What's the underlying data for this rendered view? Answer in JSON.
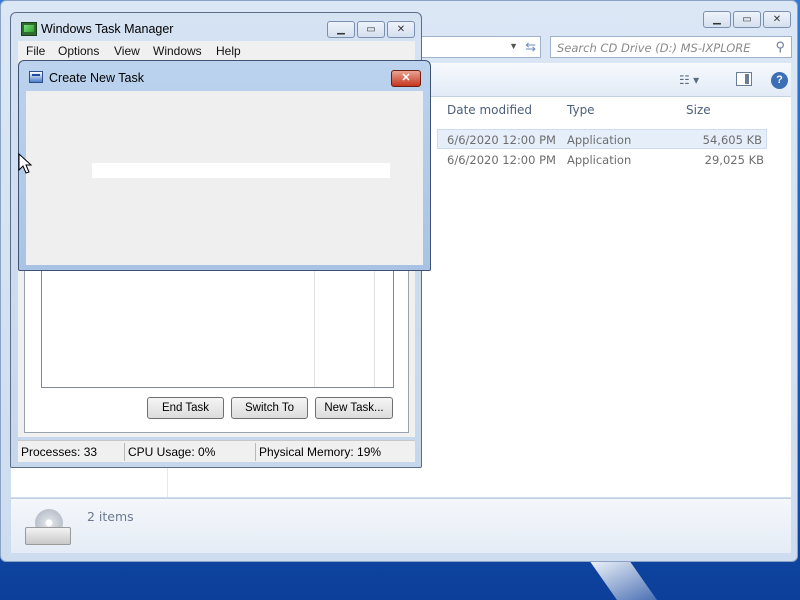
{
  "explorer": {
    "search_placeholder": "Search CD Drive (D:) MS-IXPLORE",
    "columns": {
      "date_modified": "Date modified",
      "type": "Type",
      "size": "Size"
    },
    "files": [
      {
        "date": "6/6/2020 12:00 PM",
        "type": "Application",
        "size": "54,605 KB",
        "selected": true
      },
      {
        "date": "6/6/2020 12:00 PM",
        "type": "Application",
        "size": "29,025 KB",
        "selected": false
      }
    ],
    "item_count": "2 items"
  },
  "task_manager": {
    "title": "Windows Task Manager",
    "menu": [
      "File",
      "Options",
      "View",
      "Windows",
      "Help"
    ],
    "buttons": {
      "end_task": "End Task",
      "switch_to": "Switch To",
      "new_task": "New Task..."
    },
    "status": {
      "processes": "Processes: 33",
      "cpu": "CPU Usage: 0%",
      "memory": "Physical Memory: 19%"
    }
  },
  "dialog": {
    "title": "Create New Task",
    "input_value": ""
  },
  "icons": {
    "caption_minimize": "minimize-icon",
    "caption_maximize": "maximize-icon",
    "caption_close": "close-icon"
  },
  "colors": {
    "desktop": "#1a63c4",
    "title_glass": "#c6d7ec",
    "close_red": "#c5361c"
  }
}
